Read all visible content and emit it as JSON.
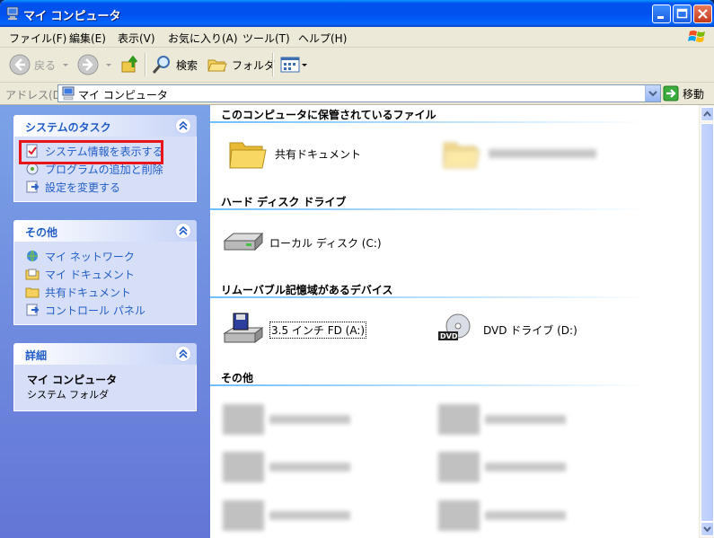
{
  "window": {
    "title": "マイ コンピュータ",
    "icon": "computer-icon",
    "controls": [
      "minimize",
      "maximize",
      "close"
    ]
  },
  "menu": {
    "items": [
      "ファイル(F)",
      "編集(E)",
      "表示(V)",
      "お気に入り(A)",
      "ツール(T)",
      "ヘルプ(H)"
    ]
  },
  "toolbar": {
    "back_label": "戻る",
    "search_label": "検索",
    "folders_label": "フォルダ"
  },
  "address": {
    "label": "アドレス(D)",
    "value": "マイ コンピュータ",
    "go_label": "移動"
  },
  "taskpane": {
    "system_tasks": {
      "header": "システムのタスク",
      "links": [
        "システム情報を表示する",
        "プログラムの追加と削除",
        "設定を変更する"
      ]
    },
    "other_places": {
      "header": "その他",
      "links": [
        "マイ ネットワーク",
        "マイ ドキュメント",
        "共有ドキュメント",
        "コントロール パネル"
      ]
    },
    "details": {
      "header": "詳細",
      "name": "マイ コンピュータ",
      "type": "システム フォルダ"
    }
  },
  "content": {
    "sections": [
      {
        "title": "このコンピュータに保管されているファイル",
        "items": [
          "共有ドキュメント"
        ]
      },
      {
        "title": "ハード ディスク ドライブ",
        "items": [
          "ローカル ディスク (C:)"
        ]
      },
      {
        "title": "リムーバブル記憶域があるデバイス",
        "items": [
          "3.5 インチ FD (A:)",
          "DVD ドライブ (D:)"
        ]
      },
      {
        "title": "その他",
        "items": []
      }
    ]
  },
  "colors": {
    "titlebar": "#0053ee",
    "taskpane_bg": "#7ba2e7",
    "link": "#215dc6",
    "highlight": "#e8141a"
  }
}
